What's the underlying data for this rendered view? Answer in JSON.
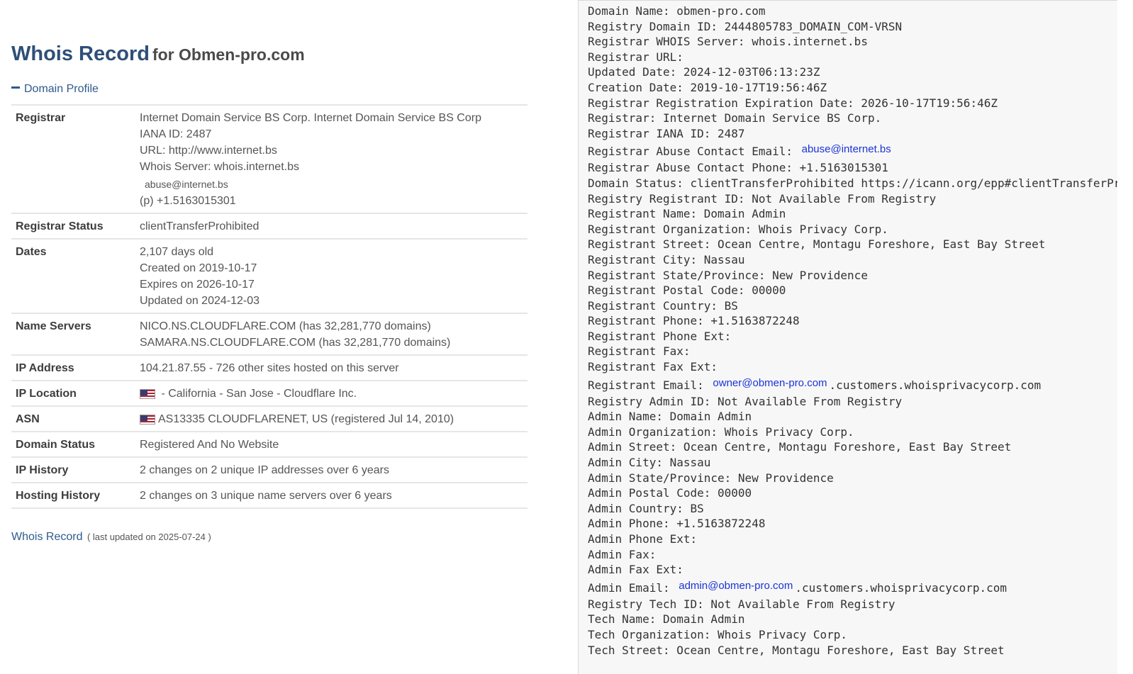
{
  "header": {
    "title_main": "Whois Record",
    "title_sub": "for Obmen-pro.com",
    "section_toggle": "Domain Profile"
  },
  "profile": {
    "registrar": {
      "label": "Registrar",
      "lines": [
        "Internet Domain Service BS Corp. Internet Domain Service BS Corp",
        "IANA ID: 2487",
        "URL: http://www.internet.bs",
        "Whois Server: whois.internet.bs"
      ],
      "email": "abuse@internet.bs",
      "phone": "(p) +1.5163015301"
    },
    "registrar_status": {
      "label": "Registrar Status",
      "value": "clientTransferProhibited"
    },
    "dates": {
      "label": "Dates",
      "lines": [
        "2,107 days old",
        "Created on 2019-10-17",
        "Expires on 2026-10-17",
        "Updated on 2024-12-03"
      ]
    },
    "name_servers": {
      "label": "Name Servers",
      "lines": [
        "NICO.NS.CLOUDFLARE.COM (has 32,281,770 domains)",
        "SAMARA.NS.CLOUDFLARE.COM (has 32,281,770 domains)"
      ]
    },
    "ip_address": {
      "label": "IP Address",
      "value": "104.21.87.55 - 726 other sites hosted on this server"
    },
    "ip_location": {
      "label": "IP Location",
      "value": "- California - San Jose - Cloudflare Inc."
    },
    "asn": {
      "label": "ASN",
      "value": "AS13335 CLOUDFLARENET, US (registered Jul 14, 2010)"
    },
    "domain_status": {
      "label": "Domain Status",
      "value": "Registered And No Website"
    },
    "ip_history": {
      "label": "IP History",
      "value": "2 changes on 2 unique IP addresses over 6 years"
    },
    "hosting_history": {
      "label": "Hosting History",
      "value": "2 changes on 3 unique name servers over 6 years"
    }
  },
  "footer": {
    "link": "Whois Record",
    "note": "( last updated on 2025-07-24 )"
  },
  "raw": {
    "l01": "Domain Name: obmen-pro.com",
    "l02": "Registry Domain ID: 2444805783_DOMAIN_COM-VRSN",
    "l03": "Registrar WHOIS Server: whois.internet.bs",
    "l04": "Registrar URL:",
    "l05": "Updated Date: 2024-12-03T06:13:23Z",
    "l06": "Creation Date: 2019-10-17T19:56:46Z",
    "l07": "Registrar Registration Expiration Date: 2026-10-17T19:56:46Z",
    "l08": "Registrar: Internet Domain Service BS Corp.",
    "l09": "Registrar IANA ID: 2487",
    "l10_prefix": "Registrar Abuse Contact Email:",
    "l10_email": "abuse@internet.bs",
    "l11": "Registrar Abuse Contact Phone: +1.5163015301",
    "l12": "Domain Status: clientTransferProhibited https://icann.org/epp#clientTransferProhibited",
    "l13": "Registry Registrant ID: Not Available From Registry",
    "l14": "Registrant Name: Domain Admin",
    "l15": "Registrant Organization: Whois Privacy Corp.",
    "l16": "Registrant Street: Ocean Centre, Montagu Foreshore, East Bay Street",
    "l17": "Registrant City: Nassau",
    "l18": "Registrant State/Province: New Providence",
    "l19": "Registrant Postal Code: 00000",
    "l20": "Registrant Country: BS",
    "l21": "Registrant Phone: +1.5163872248",
    "l22": "Registrant Phone Ext:",
    "l23": "Registrant Fax:",
    "l24": "Registrant Fax Ext:",
    "l25_prefix": "Registrant Email:",
    "l25_email": "owner@obmen-pro.com",
    "l25_suffix": ".customers.whoisprivacycorp.com",
    "l26": "Registry Admin ID: Not Available From Registry",
    "l27": "Admin Name: Domain Admin",
    "l28": "Admin Organization: Whois Privacy Corp.",
    "l29": "Admin Street: Ocean Centre, Montagu Foreshore, East Bay Street",
    "l30": "Admin City: Nassau",
    "l31": "Admin State/Province: New Providence",
    "l32": "Admin Postal Code: 00000",
    "l33": "Admin Country: BS",
    "l34": "Admin Phone: +1.5163872248",
    "l35": "Admin Phone Ext:",
    "l36": "Admin Fax:",
    "l37": "Admin Fax Ext:",
    "l38_prefix": "Admin Email:",
    "l38_email": "admin@obmen-pro.com",
    "l38_suffix": ".customers.whoisprivacycorp.com",
    "l39": "Registry Tech ID: Not Available From Registry",
    "l40": "Tech Name: Domain Admin",
    "l41": "Tech Organization: Whois Privacy Corp.",
    "l42": "Tech Street: Ocean Centre, Montagu Foreshore, East Bay Street"
  }
}
